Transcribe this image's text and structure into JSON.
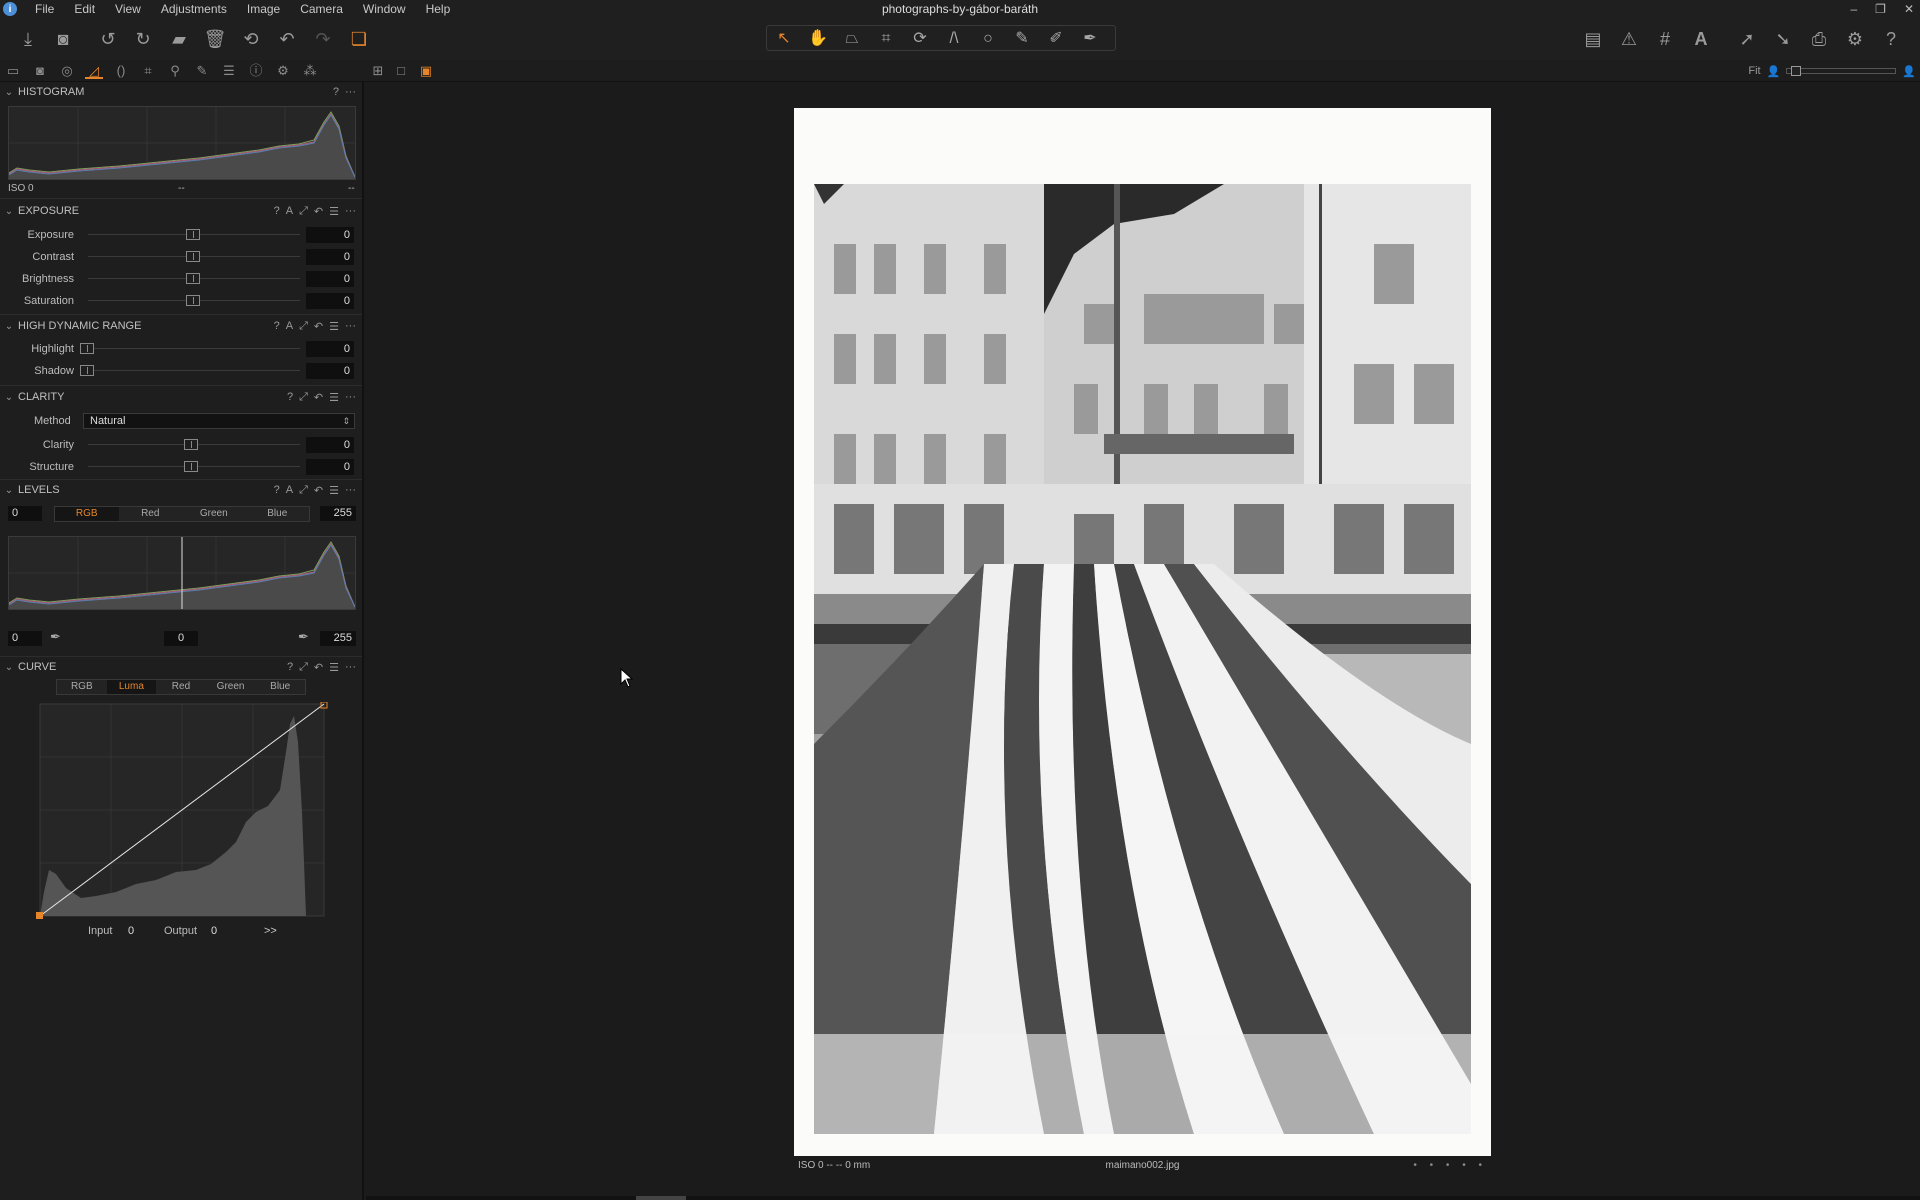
{
  "app": {
    "title": "photographs-by-gábor-baráth",
    "menu": [
      "File",
      "Edit",
      "View",
      "Adjustments",
      "Image",
      "Camera",
      "Window",
      "Help"
    ]
  },
  "toolbar": {
    "left_icons": [
      "import-icon",
      "camera-icon",
      "rotate-left-icon",
      "rotate-right-icon",
      "move-to-icon",
      "delete-icon",
      "undo-all-icon",
      "undo-icon",
      "redo-icon",
      "variants-icon"
    ],
    "cursor_tools": [
      "select-icon",
      "pan-icon",
      "keystone-icon",
      "crop-icon",
      "rotate-icon",
      "straighten-icon",
      "circle-icon",
      "brush-icon",
      "eraser-icon",
      "picker-icon"
    ],
    "right_icons": [
      "layout-icon",
      "warning-icon",
      "grid-icon",
      "text-icon",
      "export-icon",
      "process-icon",
      "print-icon",
      "settings-icon",
      "help-icon"
    ]
  },
  "zoom": {
    "label": "Fit"
  },
  "panel": {
    "histogram": {
      "title": "HISTOGRAM",
      "iso": "ISO 0",
      "mid": "--",
      "right": "--"
    },
    "exposure": {
      "title": "EXPOSURE",
      "sliders": [
        {
          "label": "Exposure",
          "value": "0"
        },
        {
          "label": "Contrast",
          "value": "0"
        },
        {
          "label": "Brightness",
          "value": "0"
        },
        {
          "label": "Saturation",
          "value": "0"
        }
      ]
    },
    "hdr": {
      "title": "HIGH DYNAMIC RANGE",
      "sliders": [
        {
          "label": "Highlight",
          "value": "0"
        },
        {
          "label": "Shadow",
          "value": "0"
        }
      ]
    },
    "clarity": {
      "title": "CLARITY",
      "method_label": "Method",
      "method_value": "Natural",
      "sliders": [
        {
          "label": "Clarity",
          "value": "0"
        },
        {
          "label": "Structure",
          "value": "0"
        }
      ]
    },
    "levels": {
      "title": "LEVELS",
      "in_low": "0",
      "in_high": "255",
      "channels": [
        "RGB",
        "Red",
        "Green",
        "Blue"
      ],
      "active_channel": "RGB",
      "out_low": "0",
      "mid": "0",
      "out_high": "255"
    },
    "curve": {
      "title": "CURVE",
      "channels": [
        "RGB",
        "Luma",
        "Red",
        "Green",
        "Blue"
      ],
      "active_channel": "Luma",
      "input_label": "Input",
      "input_value": "0",
      "output_label": "Output",
      "output_value": "0",
      "more": ">>"
    }
  },
  "viewer": {
    "caption_left": "ISO 0 -- -- 0 mm",
    "caption_center": "maimano002.jpg",
    "caption_right": "• • • • •"
  },
  "colors": {
    "accent": "#e7852b",
    "panel_bg": "#1e1e1e",
    "viewer_bg": "#1b1b1b"
  }
}
